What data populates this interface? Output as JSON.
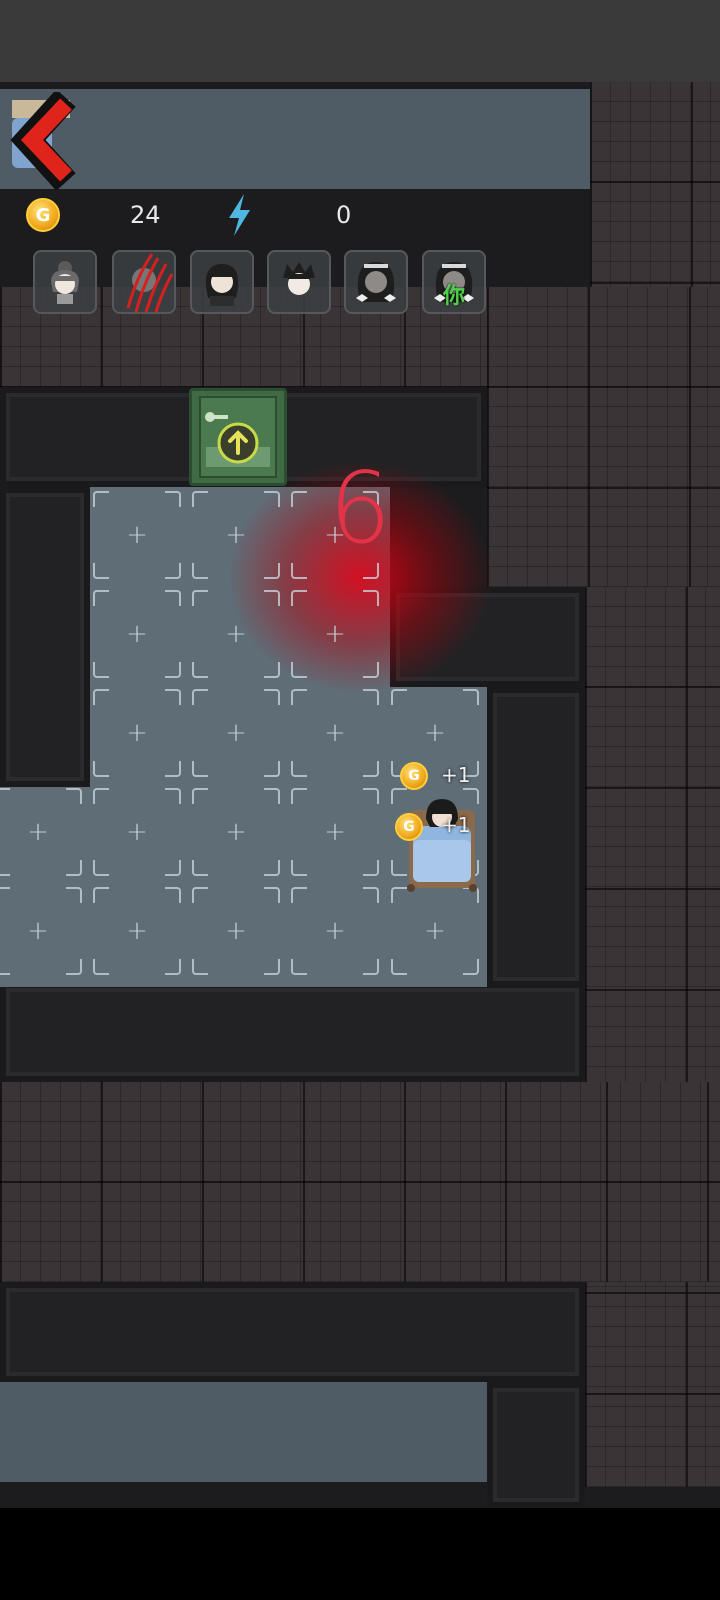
{
  "hud": {
    "coin_icon": "gold-coin-icon",
    "coin_symbol": "G",
    "coins": "24",
    "energy_icon": "lightning-bolt-icon",
    "energy": "0",
    "back_icon": "red-back-arrow-icon"
  },
  "portraits": [
    {
      "name": "portrait-girl-bun",
      "icon": "girl-with-bun-icon"
    },
    {
      "name": "portrait-ghost-clawed",
      "icon": "ghost-with-claw-marks-icon"
    },
    {
      "name": "portrait-dark-hair-girl",
      "icon": "dark-haired-girl-icon"
    },
    {
      "name": "portrait-boy-spiky",
      "icon": "spiky-haired-boy-icon"
    },
    {
      "name": "portrait-girl-ribbons",
      "icon": "girl-with-ribbons-icon"
    },
    {
      "name": "portrait-girl-ribbons-selected",
      "icon": "girl-with-ribbons-icon",
      "label": "你"
    }
  ],
  "room": {
    "door_icon": "upgrade-arrow-door-icon",
    "danger_countdown": "6",
    "bed_icon": "bed-icon",
    "player_icon": "player-character-icon",
    "tile_plus": "+",
    "income": [
      {
        "coin": "G",
        "text": "+1"
      },
      {
        "coin": "G",
        "text": "+1"
      }
    ]
  },
  "colors": {
    "accent_red": "#e23348",
    "coin_gold": "#f0a81c",
    "energy_blue": "#4fb7e0",
    "door_green": "#3f6a43"
  }
}
